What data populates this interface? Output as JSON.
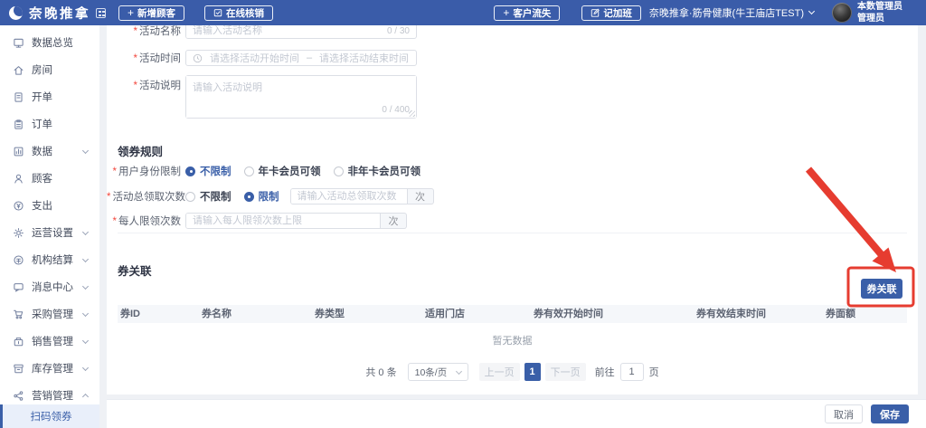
{
  "header": {
    "brand": "奈晚推拿",
    "new_customer_btn": "新增顾客",
    "online_verify_btn": "在线核销",
    "customer_loss_btn": "客户流失",
    "overtime_btn": "记加班",
    "store_selector": "奈晚推拿·筋骨健康(牛王庙店TEST)",
    "user_name": "本数管理员",
    "user_role": "管理员"
  },
  "sidebar": {
    "items": [
      {
        "label": "数据总览",
        "icon": "dashboard-icon",
        "expandable": false,
        "expanded": false
      },
      {
        "label": "房间",
        "icon": "room-icon",
        "expandable": false,
        "expanded": false
      },
      {
        "label": "开单",
        "icon": "billing-icon",
        "expandable": false,
        "expanded": false
      },
      {
        "label": "订单",
        "icon": "order-icon",
        "expandable": false,
        "expanded": false
      },
      {
        "label": "数据",
        "icon": "data-icon",
        "expandable": true,
        "expanded": false
      },
      {
        "label": "顾客",
        "icon": "customer-icon",
        "expandable": false,
        "expanded": false
      },
      {
        "label": "支出",
        "icon": "expense-icon",
        "expandable": false,
        "expanded": false
      },
      {
        "label": "运营设置",
        "icon": "settings-icon",
        "expandable": true,
        "expanded": false
      },
      {
        "label": "机构结算",
        "icon": "settlement-icon",
        "expandable": true,
        "expanded": false
      },
      {
        "label": "消息中心",
        "icon": "message-icon",
        "expandable": true,
        "expanded": false
      },
      {
        "label": "采购管理",
        "icon": "purchase-icon",
        "expandable": true,
        "expanded": false
      },
      {
        "label": "销售管理",
        "icon": "sales-icon",
        "expandable": true,
        "expanded": false
      },
      {
        "label": "库存管理",
        "icon": "inventory-icon",
        "expandable": true,
        "expanded": false
      },
      {
        "label": "营销管理",
        "icon": "marketing-icon",
        "expandable": true,
        "expanded": true
      }
    ],
    "active_subitem": "扫码领券"
  },
  "form": {
    "name": {
      "label": "活动名称",
      "placeholder": "请输入活动名称",
      "counter": "0 / 30"
    },
    "time": {
      "label": "活动时间",
      "start_placeholder": "请选择活动开始时间",
      "separator": "–",
      "end_placeholder": "请选择活动结束时间"
    },
    "desc": {
      "label": "活动说明",
      "placeholder": "请输入活动说明",
      "counter": "0 / 400"
    }
  },
  "rules_section": {
    "title": "领券规则",
    "identity": {
      "label": "用户身份限制",
      "options": [
        {
          "label": "不限制",
          "selected": true
        },
        {
          "label": "年卡会员可领",
          "selected": false
        },
        {
          "label": "非年卡会员可领",
          "selected": false
        }
      ]
    },
    "total_limit": {
      "label": "活动总领取次数",
      "options": [
        {
          "label": "不限制",
          "selected": false
        },
        {
          "label": "限制",
          "selected": true
        }
      ],
      "placeholder": "请输入活动总领取次数",
      "unit": "次"
    },
    "per_person": {
      "label": "每人限领次数",
      "placeholder": "请输入每人限领次数上限",
      "unit": "次"
    }
  },
  "coupon_section": {
    "title": "券关联",
    "link_button": "券关联",
    "table_headers": [
      "券ID",
      "券名称",
      "券类型",
      "适用门店",
      "券有效开始时间",
      "券有效结束时间",
      "券面额"
    ],
    "empty_text": "暂无数据",
    "pagination": {
      "total": "共 0 条",
      "page_size": "10条/页",
      "prev": "上一页",
      "current": "1",
      "next": "下一页",
      "goto_prefix": "前往",
      "goto_value": "1",
      "goto_suffix": "页"
    }
  },
  "footer": {
    "cancel": "取消",
    "save": "保存"
  },
  "colors": {
    "primary": "#3a5fa8",
    "header_bg": "#3a5ca9",
    "annotation_red": "#e63c30",
    "active_nav_bg": "#e9effa"
  }
}
